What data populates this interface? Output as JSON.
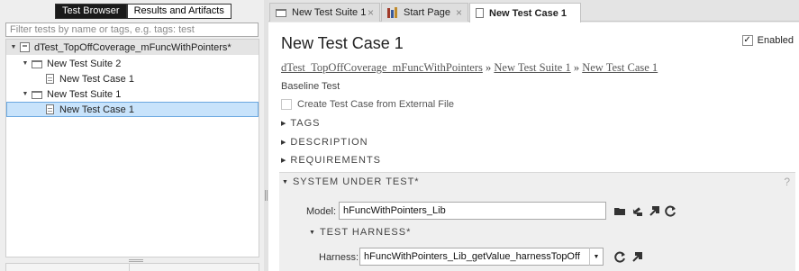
{
  "left_pane": {
    "tabs": [
      {
        "label": "Test Browser",
        "active": true
      },
      {
        "label": "Results and Artifacts",
        "active": false
      }
    ],
    "filter_placeholder": "Filter tests by name or tags, e.g. tags: test",
    "tree": [
      {
        "label": "dTest_TopOffCoverage_mFuncWithPointers*",
        "expanded": true,
        "icon": "test-file-icon"
      },
      {
        "label": "New Test Suite 2",
        "expanded": true,
        "icon": "folder-icon"
      },
      {
        "label": "New Test Case 1",
        "icon": "test-case-icon"
      },
      {
        "label": "New Test Suite 1",
        "expanded": true,
        "icon": "folder-icon"
      },
      {
        "label": "New Test Case 1",
        "icon": "test-case-icon",
        "selected": true
      }
    ]
  },
  "doc_tabs": [
    {
      "label": "New Test Suite 1",
      "icon": "folder-icon",
      "close": "×"
    },
    {
      "label": "Start Page",
      "icon": "books-icon",
      "close": "×"
    },
    {
      "label": "New Test Case 1",
      "icon": "test-case-icon",
      "active": true
    }
  ],
  "content": {
    "title": "New Test Case 1",
    "enabled_label": "Enabled",
    "enabled_checked": true,
    "checkmark": "✓",
    "breadcrumb": {
      "file": "dTest_TopOffCoverage_mFuncWithPointers",
      "suite": "New Test Suite 1",
      "case": "New Test Case 1",
      "separator": "»"
    },
    "test_type": "Baseline Test",
    "create_external_label": "Create Test Case from External File",
    "sections": {
      "tags": "TAGS",
      "description": "DESCRIPTION",
      "requirements": "REQUIREMENTS",
      "system_under_test": "SYSTEM UNDER TEST*",
      "test_harness": "TEST HARNESS*"
    },
    "help_glyph": "?",
    "model_label": "Model:",
    "model_value": "hFuncWithPointers_Lib",
    "harness_label": "Harness:",
    "harness_value": "hFuncWithPointers_Lib_getValue_harnessTopOff"
  },
  "colors": {
    "selection_bg": "#c8e3fb",
    "selection_border": "#6aa8e0",
    "link_text": "#555555",
    "panel_bg": "#efefef"
  }
}
